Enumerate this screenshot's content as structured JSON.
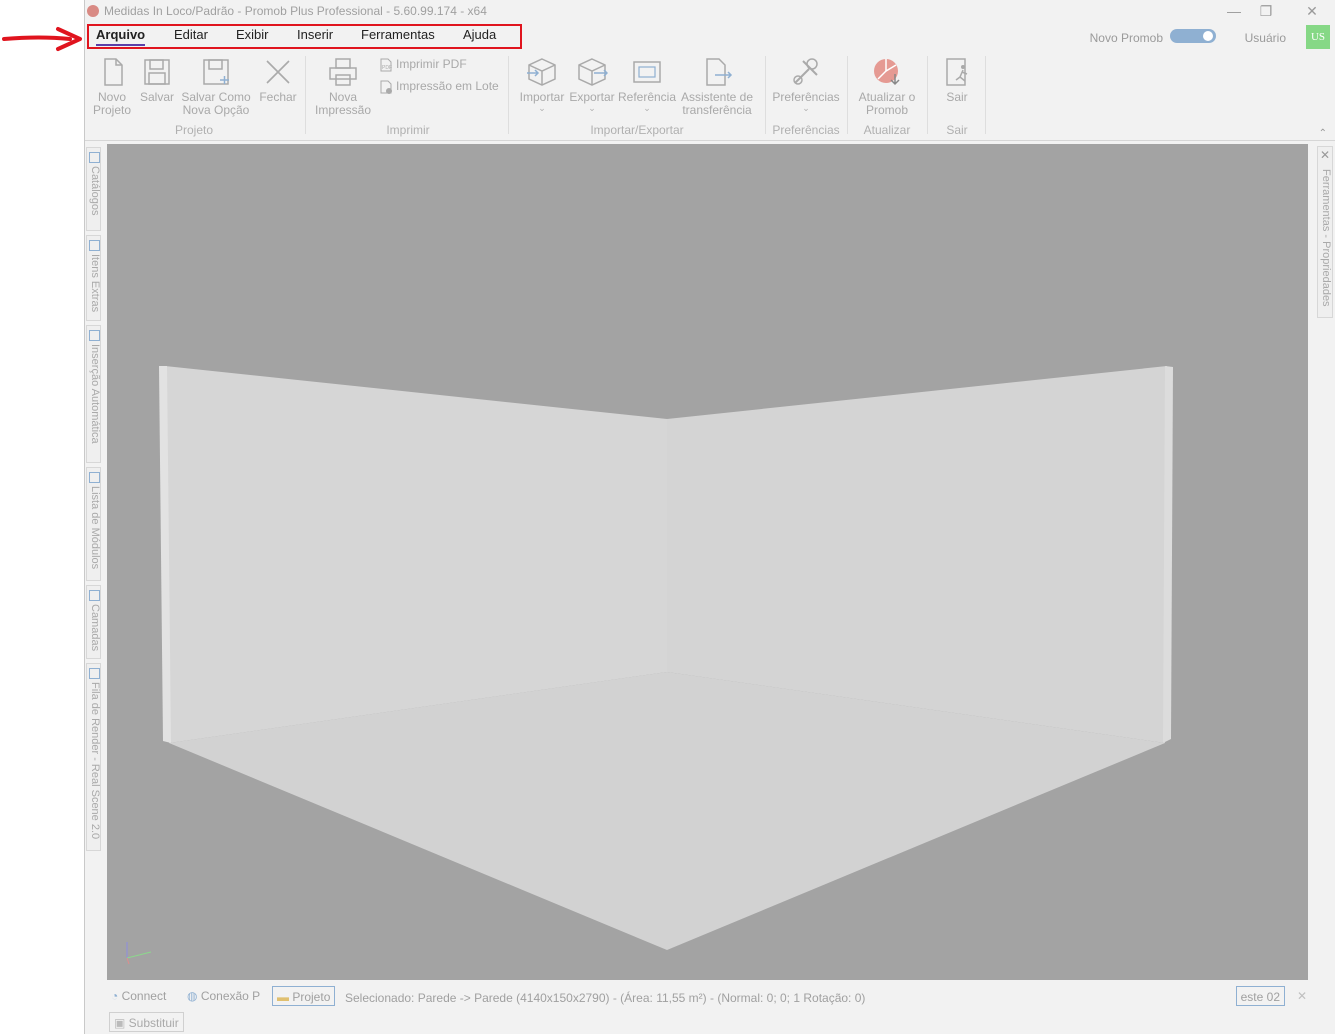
{
  "window": {
    "title": "Medidas In Loco/Padrão - Promob Plus Professional - 5.60.99.174 - x64",
    "minimize": "—",
    "restore": "❐",
    "close": "✕"
  },
  "menu": {
    "items": [
      {
        "label": "Arquivo",
        "active": true
      },
      {
        "label": "Editar"
      },
      {
        "label": "Exibir"
      },
      {
        "label": "Inserir"
      },
      {
        "label": "Ferramentas"
      },
      {
        "label": "Ajuda"
      }
    ],
    "novo_promob": "Novo Promob",
    "user_label": "Usuário",
    "avatar": "US"
  },
  "ribbon": {
    "novo_projeto": "Novo\nProjeto",
    "salvar": "Salvar",
    "salvar_como": "Salvar Como\nNova Opção",
    "fechar": "Fechar",
    "nova_impressao": "Nova\nImpressão",
    "imprimir_pdf": "Imprimir PDF",
    "impressao_lote": "Impressão em Lote",
    "importar": "Importar",
    "exportar": "Exportar",
    "referencia": "Referência",
    "assistente": "Assistente de\ntransferência",
    "preferencias": "Preferências",
    "atualizar": "Atualizar o\nPromob",
    "sair": "Sair",
    "groups": {
      "projeto": "Projeto",
      "imprimir": "Imprimir",
      "importar_exportar": "Importar/Exportar",
      "preferencias": "Preferências",
      "atualizar": "Atualizar",
      "sair": "Sair"
    }
  },
  "side_tabs": {
    "left": [
      "Catálogos",
      "Itens Extras",
      "Inserção Automática",
      "Lista de Módulos",
      "Camadas",
      "Fila de Render - Real Scene 2.0"
    ],
    "right": "Ferramentas - Propriedades"
  },
  "status": {
    "connect": "Connect",
    "conexao": "Conexão P",
    "projeto": "Projeto",
    "selection": "Selecionado: Parede -> Parede (4140x150x2790) - (Área: 11,55 m²) - (Normal: 0; 0; 1 Rotação: 0)",
    "tab": "este 02",
    "close": "✕"
  },
  "bottom": {
    "substituir": "Substituir"
  },
  "colors": {
    "highlight": "#e0141e",
    "accent": "#5a3fa8",
    "toggle": "#8fb0d2",
    "avatar": "#86d886"
  }
}
